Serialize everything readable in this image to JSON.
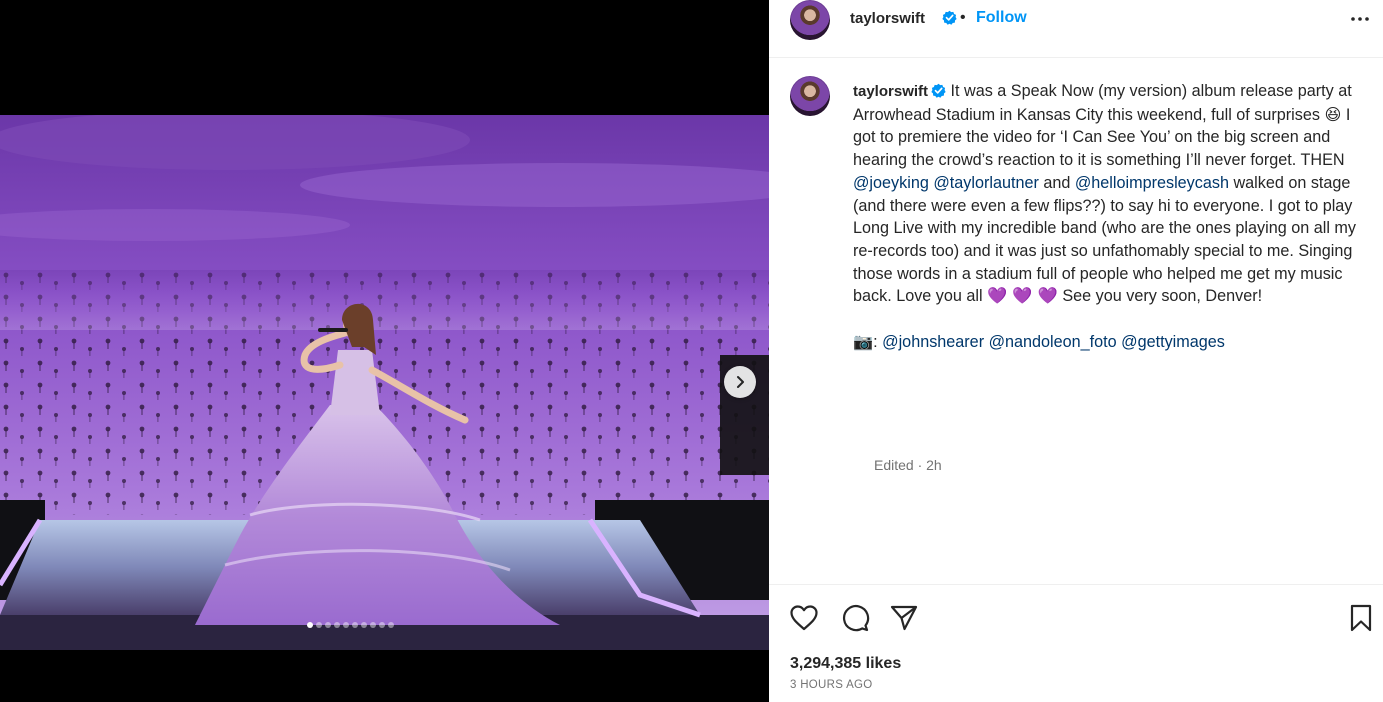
{
  "header": {
    "username": "taylorswift",
    "separator": "•",
    "follow_label": "Follow"
  },
  "caption": {
    "username": "taylorswift",
    "segments": {
      "s1": "It was a Speak Now (my version) album release party at Arrowhead Stadium in Kansas City this weekend, full of surprises ",
      "e1": "😆",
      "s2": " I got to premiere the video for ‘I Can See You’ on the big screen and hearing the crowd’s reaction to it is something I’ll never forget. THEN ",
      "m1": "@joeyking",
      "m2": "@taylorlautner",
      "s3": " and ",
      "m3": "@helloimpresleycash",
      "s4": " walked on stage (and there were even a few flips??) to say hi to everyone. I got to play Long Live with my incredible band (who are the ones playing on all my re-records too) and it was just so unfathomably special to me. Singing those words in a stadium full of people who helped me get my music back. Love you all ",
      "hearts": "💜 💜 💜",
      "s5": " See you very soon, Denver!",
      "camera": "📷",
      "credit_sep": ": ",
      "c1": "@johnshearer",
      "c2": "@nandoleon_foto",
      "c3": "@gettyimages"
    },
    "meta": "Edited · 2h"
  },
  "media": {
    "slide_count": 10,
    "active_slide": 1
  },
  "engagement": {
    "likes": "3,294,385 likes",
    "timestamp": "3 HOURS AGO"
  },
  "icons": {
    "more": "more-options-icon",
    "next": "chevron-right-icon",
    "like": "heart-icon",
    "comment": "comment-icon",
    "share": "share-icon",
    "save": "bookmark-icon",
    "verified": "verified-badge-icon"
  },
  "colors": {
    "accent": "#0095f6",
    "mention": "#00376b",
    "verified": "#0095f6",
    "secondary_text": "#737373",
    "stage_purple": "#7b3fb5"
  }
}
